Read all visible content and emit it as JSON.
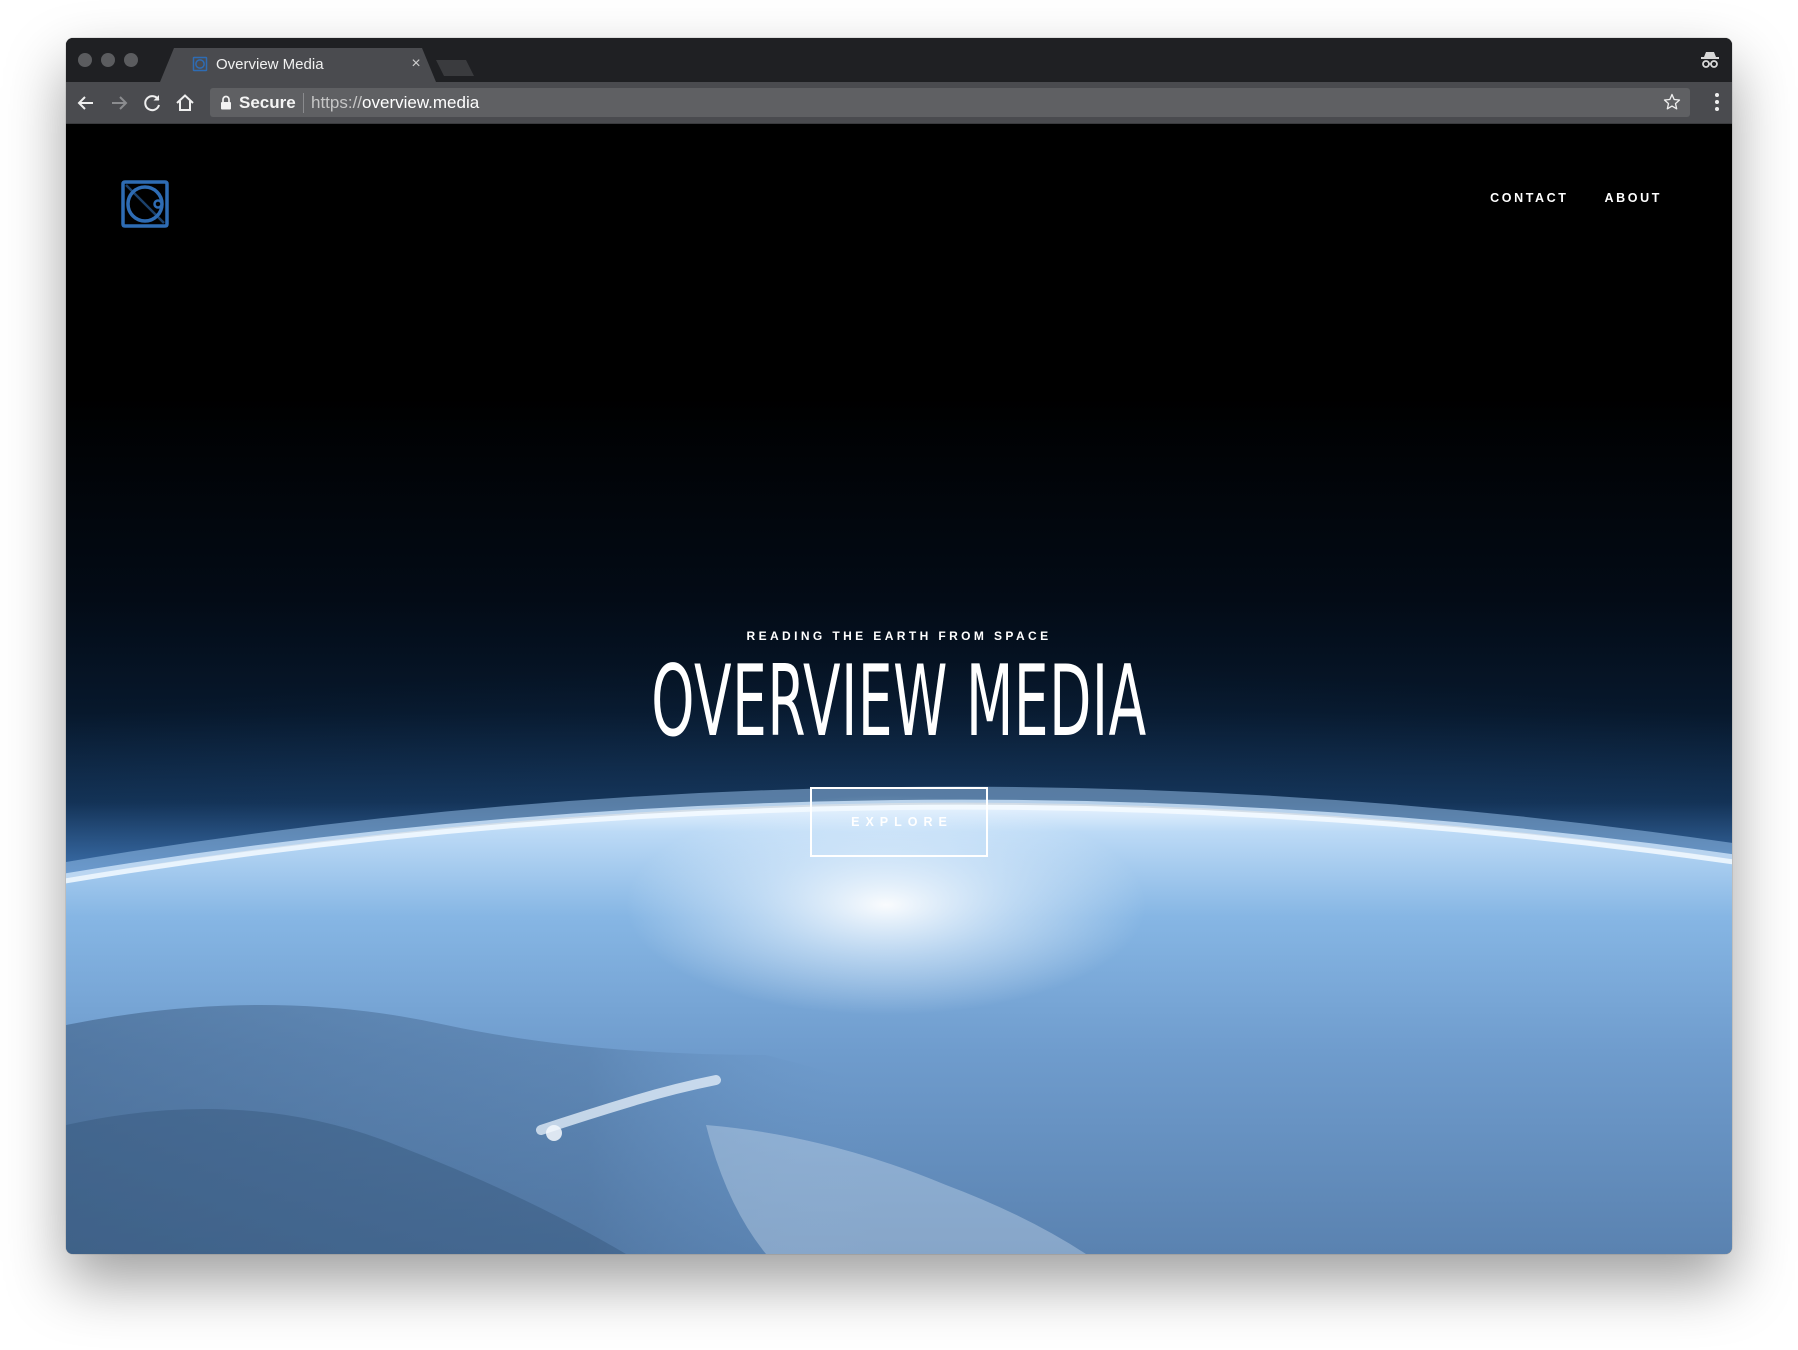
{
  "browser": {
    "tab": {
      "title": "Overview Media",
      "close_glyph": "×",
      "favicon": "overview-logo-icon"
    },
    "toolbar": {
      "back": "back-arrow-icon",
      "forward": "forward-arrow-icon",
      "reload": "reload-icon",
      "home": "home-icon",
      "bookmark": "star-icon",
      "menu": "menu-dots-icon"
    },
    "omnibox": {
      "security_label": "Secure",
      "url_scheme": "https://",
      "url_host": "overview.media"
    },
    "incognito": "incognito-icon"
  },
  "site": {
    "logo": "overview-logo-icon",
    "nav": [
      {
        "label": "CONTACT"
      },
      {
        "label": "ABOUT"
      }
    ],
    "hero": {
      "eyebrow": "READING THE EARTH FROM SPACE",
      "title": "OVERVIEW MEDIA",
      "cta": "EXPLORE"
    }
  },
  "colors": {
    "logo_blue": "#2e6cb4",
    "space": "#000000",
    "atmosphere": "#dfeefc",
    "earth": "#6f9fd2"
  }
}
